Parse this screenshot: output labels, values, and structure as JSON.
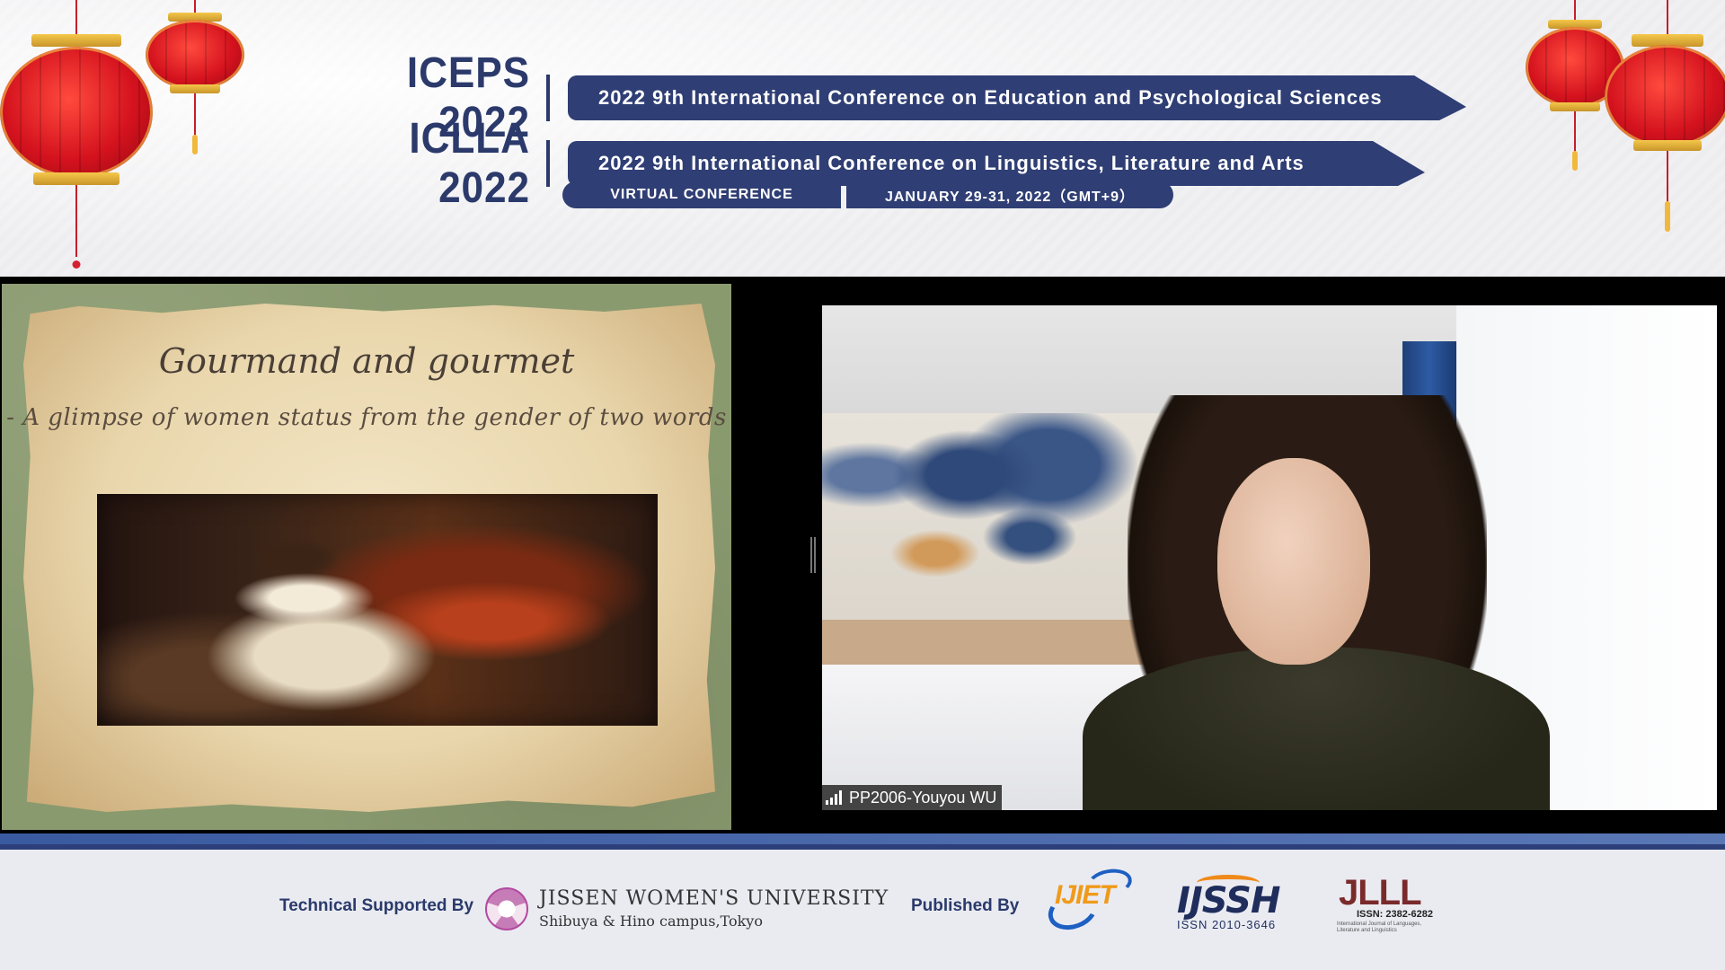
{
  "header": {
    "conferences": [
      {
        "acronym": "ICEPS 2022",
        "full_name": "2022 9th International Conference on Education and Psychological Sciences"
      },
      {
        "acronym": "ICLLA 2022",
        "full_name": "2022 9th International Conference on Linguistics, Literature and Arts"
      }
    ],
    "format_label": "VIRTUAL CONFERENCE",
    "dates_label": "JANUARY 29-31, 2022（GMT+9）"
  },
  "shared_slide": {
    "title": "Gourmand and gourmet",
    "subtitle": "- A glimpse of women status from the gender of two words"
  },
  "video_tile": {
    "participant_name": "PP2006-Youyou WU",
    "connection_icon": "signal-bars-icon"
  },
  "footer": {
    "supported_label": "Technical Supported By",
    "university_name": "JISSEN WOMEN'S UNIVERSITY",
    "university_campus": "Shibuya & Hino campus,Tokyo",
    "published_label": "Published By",
    "journals": [
      {
        "mark": "IJIET"
      },
      {
        "mark": "IJSSH",
        "issn": "ISSN 2010-3646"
      },
      {
        "mark": "JLLL",
        "issn": "ISSN: 2382-6282",
        "subtitle": "International Journal of Languages, Literature and Linguistics"
      }
    ]
  },
  "colors": {
    "brand_navy": "#2f3e74",
    "accent_blue": "#3a5aa0",
    "lantern_red": "#d4121e"
  }
}
